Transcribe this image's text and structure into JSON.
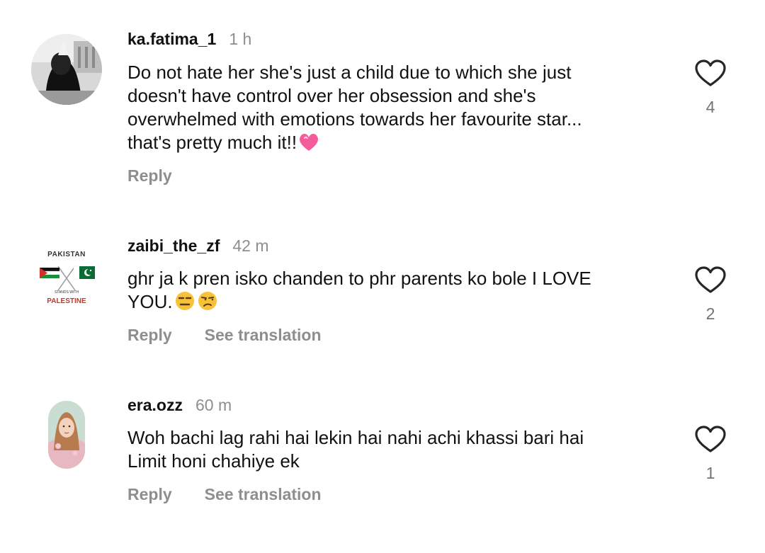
{
  "comments": [
    {
      "username": "ka.fatima_1",
      "time": "1 h",
      "text": "Do not hate her she's just a child due to which she just doesn't have control over her obsession and she's overwhelmed with emotions towards her favourite star... that's pretty much it!!",
      "emoji": "beating-heart",
      "reply_label": "Reply",
      "like_count": "4"
    },
    {
      "username": "zaibi_the_zf",
      "time": "42 m",
      "text": "ghr ja k pren isko chanden to phr parents ko bole I LOVE YOU.",
      "emoji": "expressionless-face, unamused-face",
      "reply_label": "Reply",
      "see_translation_label": "See translation",
      "like_count": "2",
      "avatar_text_top": "PAKISTAN",
      "avatar_text_mid": "STANDS WITH",
      "avatar_text_bottom": "PALESTINE"
    },
    {
      "username": "era.ozz",
      "time": "60 m",
      "text": "Woh bachi lag rahi hai lekin hai nahi achi khassi bari hai Limit honi chahiye ek",
      "reply_label": "Reply",
      "see_translation_label": "See translation",
      "like_count": "1"
    }
  ],
  "colors": {
    "text": "#111111",
    "muted": "#8e8e8e",
    "count": "#737373",
    "heart_outline": "#262626",
    "emoji_heart": "#f35b9a"
  }
}
